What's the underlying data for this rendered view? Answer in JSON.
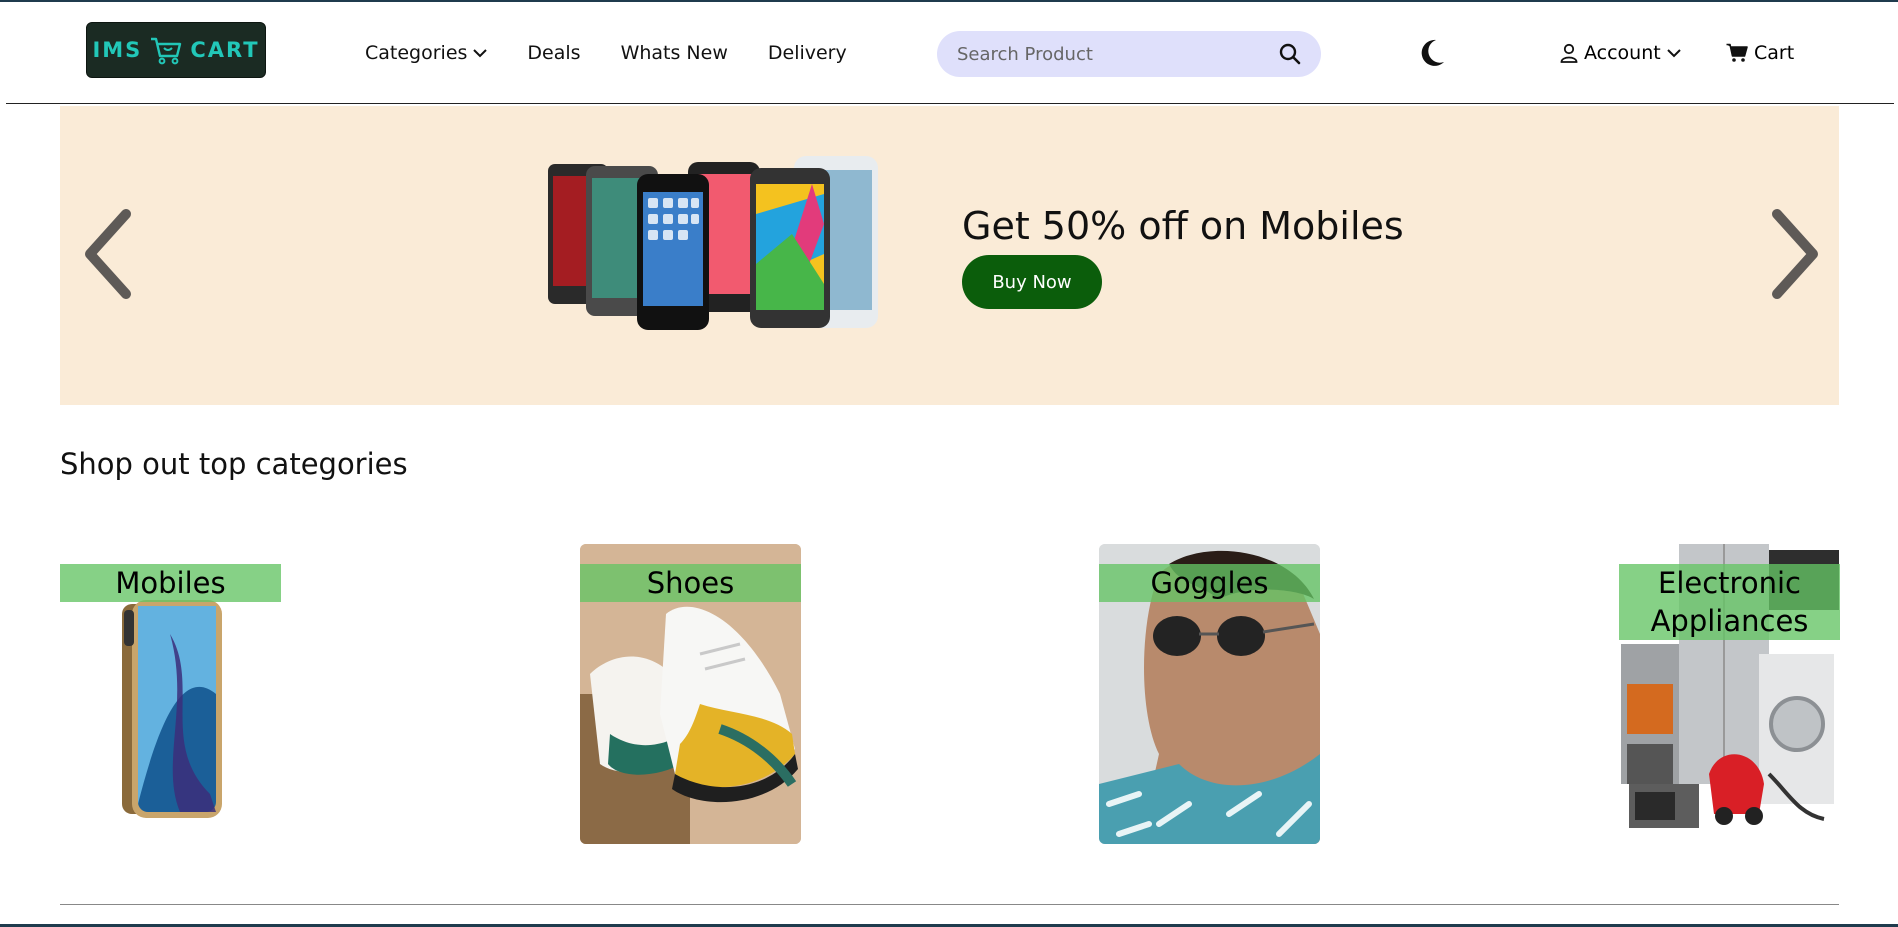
{
  "header": {
    "logo": {
      "left": "IMS",
      "right": "CART"
    },
    "nav": [
      {
        "label": "Categories",
        "has_dropdown": true
      },
      {
        "label": "Deals",
        "has_dropdown": false
      },
      {
        "label": "Whats New",
        "has_dropdown": false
      },
      {
        "label": "Delivery",
        "has_dropdown": false
      }
    ],
    "search": {
      "placeholder": "Search Product",
      "value": ""
    },
    "theme_icon": "moon-icon",
    "account_label": "Account",
    "cart_label": "Cart"
  },
  "hero": {
    "title": "Get 50% off on Mobiles",
    "button_label": "Buy Now",
    "background": "#faebd7",
    "button_color": "#0b5d0b"
  },
  "categories_section": {
    "title": "Shop out top categories",
    "items": [
      {
        "label": "Mobiles",
        "icon": "smartphone-image"
      },
      {
        "label": "Shoes",
        "icon": "sneakers-image"
      },
      {
        "label": "Goggles",
        "icon": "sunglasses-model-image"
      },
      {
        "label": "Electronic Appliances",
        "icon": "appliances-image"
      }
    ]
  },
  "colors": {
    "accent_label_bg": "#64c464",
    "search_bg": "#dfe0fb",
    "logo_bg": "#1b2b23",
    "logo_text": "#22c7b8"
  }
}
